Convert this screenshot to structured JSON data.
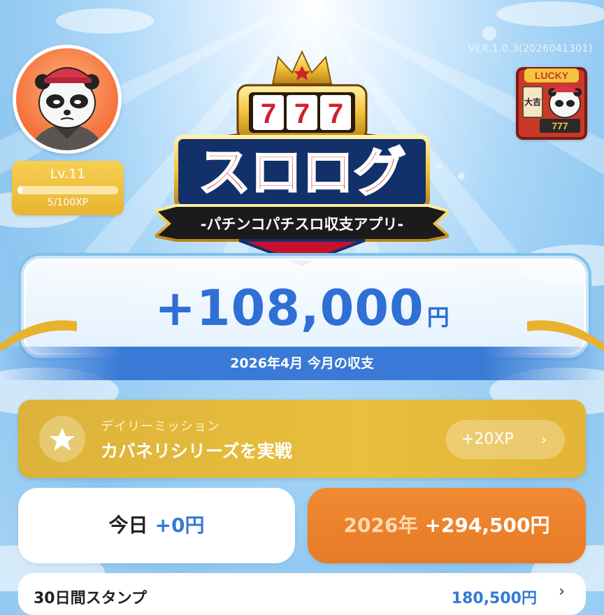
{
  "app": {
    "version": "VER.1.0.3(2026041301)"
  },
  "logo": {
    "title": "スロログ",
    "slot_digits": [
      "7",
      "7",
      "7"
    ],
    "subtitle": "-パチンコパチスロ収支アプリ-"
  },
  "player": {
    "level_label": "Lv.11",
    "xp_text": "5/100XP",
    "xp_progress": 0.05
  },
  "lucky_icon": {
    "sign": "LUCKY",
    "charm": "大吉",
    "digits": "777"
  },
  "monthly": {
    "amount": "+108,000",
    "unit": "円",
    "caption": "2026年4月 今月の収支"
  },
  "mission": {
    "label": "デイリーミッション",
    "title": "カバネリシリーズを実戦",
    "reward": "+20XP",
    "icon": "star-icon"
  },
  "today": {
    "label": "今日",
    "value": "+0円"
  },
  "year": {
    "label": "2026年",
    "value": "+294,500円"
  },
  "stamp": {
    "title": "30日間スタンプ",
    "value": "180,500円"
  },
  "colors": {
    "accent_blue": "#3479d6",
    "gold": "#e8bf3e",
    "orange": "#e87a26"
  }
}
